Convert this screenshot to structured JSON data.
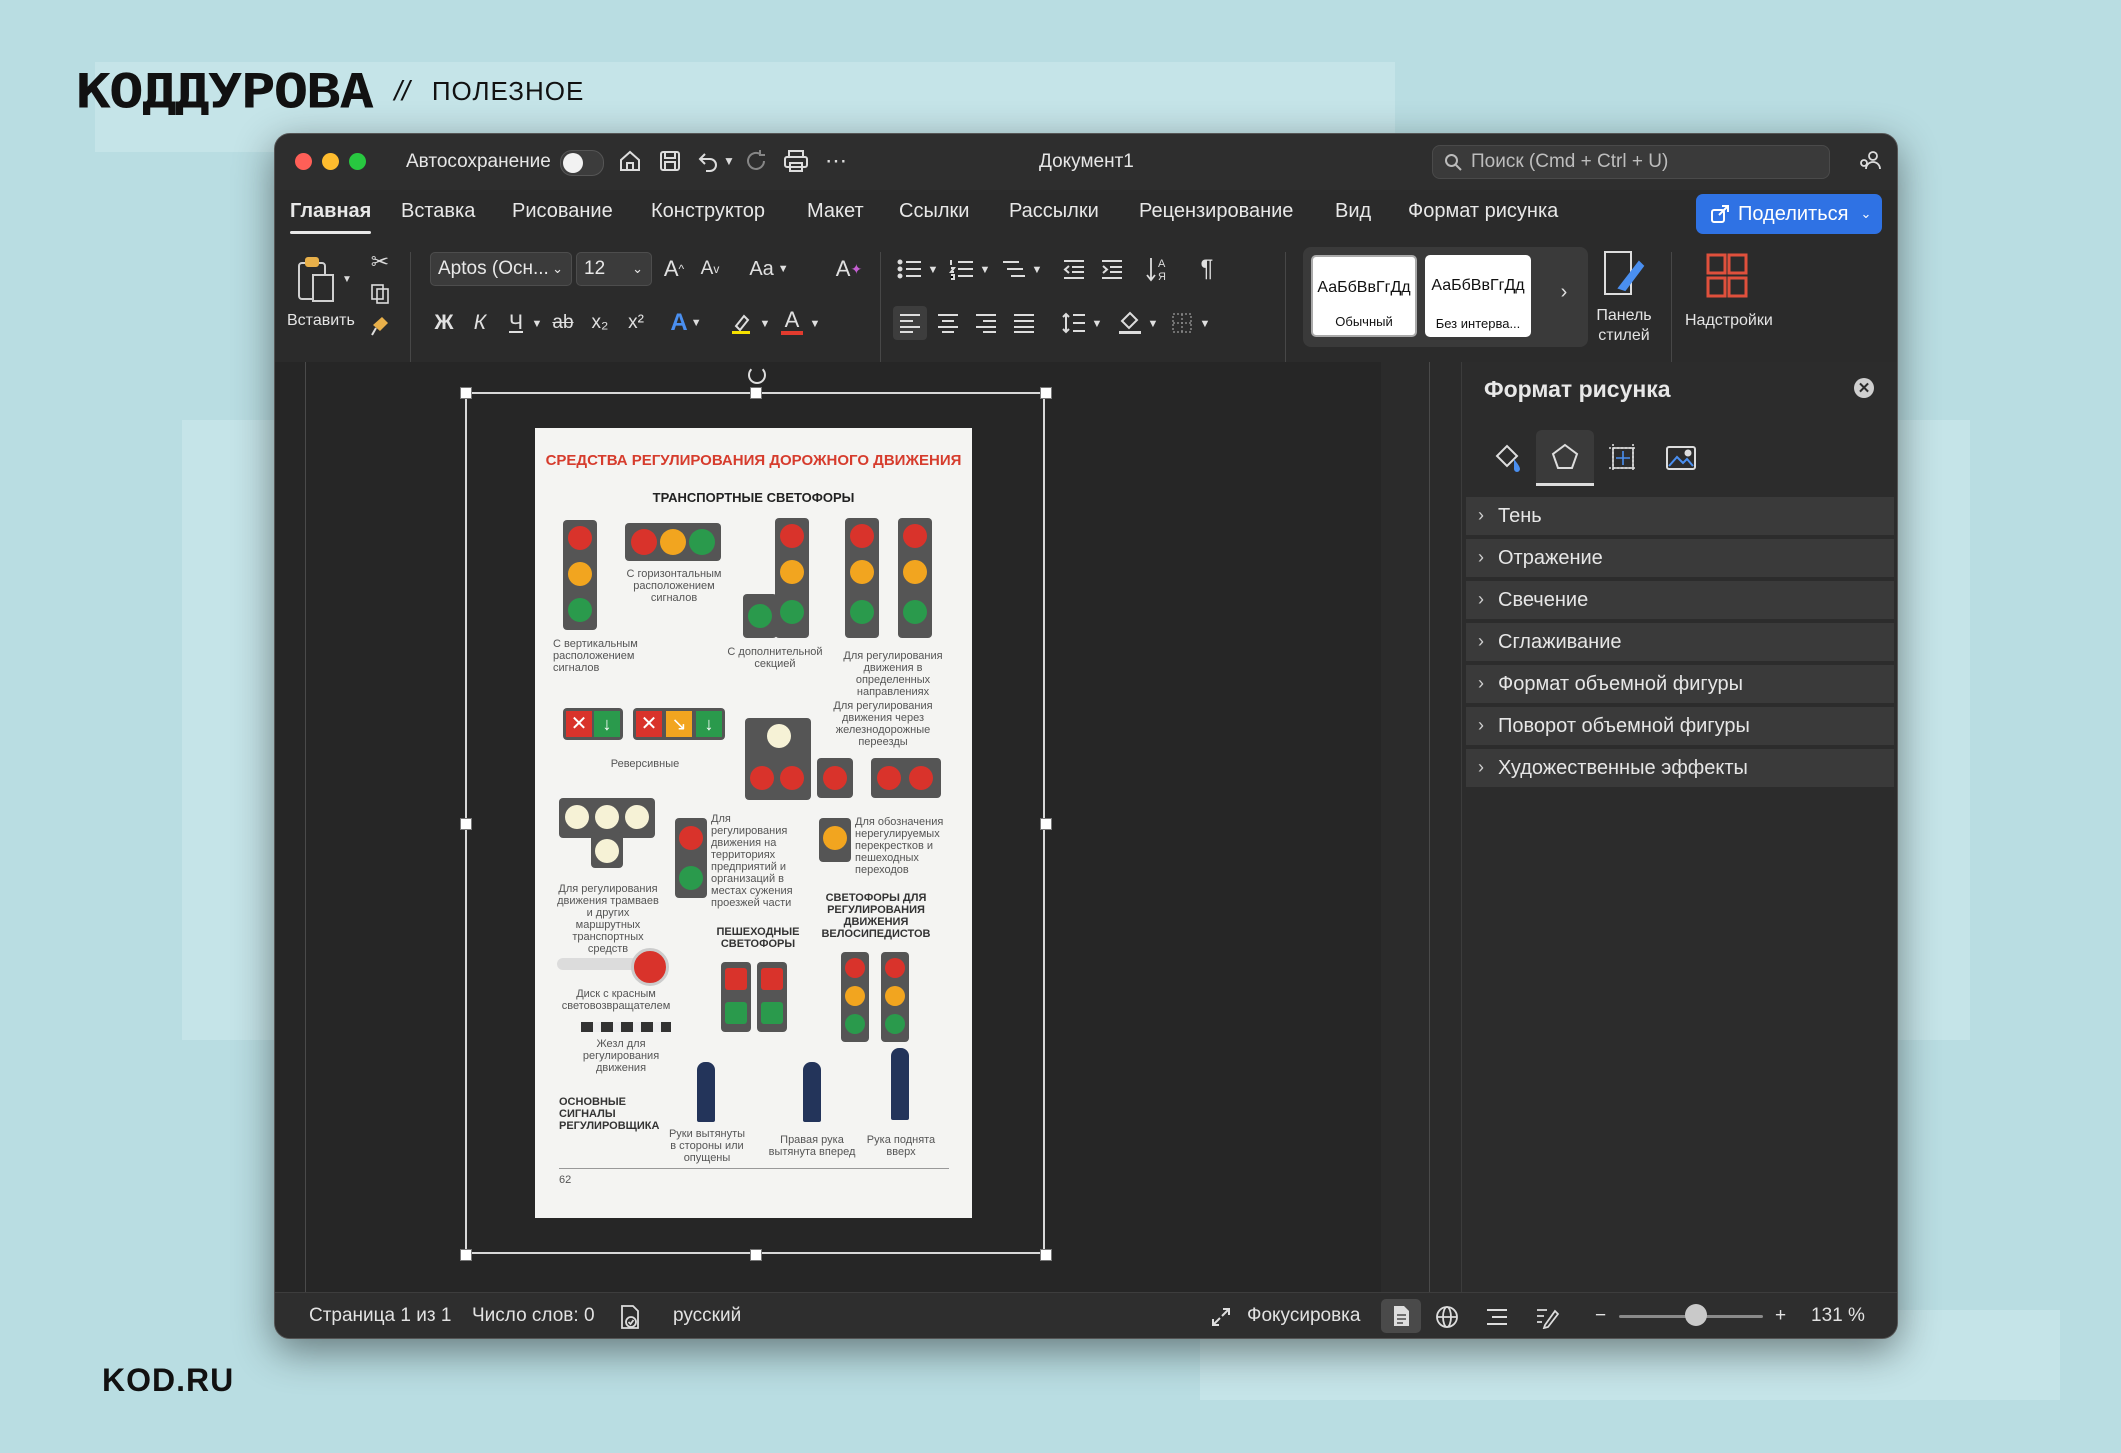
{
  "brand": {
    "logo": "КОДДУРОВА",
    "divider": "//",
    "section": "ПОЛЕЗНОЕ",
    "site": "KOD.RU"
  },
  "window": {
    "autosave_label": "Автосохранение",
    "document_title": "Документ1",
    "search_placeholder": "Поиск (Cmd + Ctrl + U)",
    "colors": {
      "close": "#ff5f57",
      "minimize": "#febc2e",
      "maximize": "#28c840",
      "accent": "#2f72e4"
    }
  },
  "tabs": [
    "Главная",
    "Вставка",
    "Рисование",
    "Конструктор",
    "Макет",
    "Ссылки",
    "Рассылки",
    "Рецензирование",
    "Вид",
    "Формат рисунка"
  ],
  "share_label": "Поделиться",
  "ribbon": {
    "paste_label": "Вставить",
    "font_name": "Aptos (Осн...",
    "font_size": "12",
    "bold": "Ж",
    "italic": "К",
    "underline": "Ч",
    "strike": "ab",
    "subscript": "x₂",
    "superscript": "x²",
    "case_label": "Aa",
    "styles": [
      {
        "sample": "АаБбВвГгДд",
        "name": "Обычный"
      },
      {
        "sample": "АаБбВвГгДд",
        "name": "Без интерва..."
      }
    ],
    "styles_pane_label": "Панель стилей",
    "addins_label": "Надстройки"
  },
  "poster": {
    "title": "СРЕДСТВА РЕГУЛИРОВАНИЯ ДОРОЖНОГО ДВИЖЕНИЯ",
    "subtitle": "ТРАНСПОРТНЫЕ СВЕТОФОРЫ",
    "captions": {
      "vertical": "С вертикальным расположением сигналов",
      "horizontal": "С горизонтальным расположением сигналов",
      "extra": "С дополнительной секцией",
      "directions": "Для регулирования движения в определенных направлениях",
      "reversible": "Реверсивные",
      "railway": "Для регулирования движения через железнодорожные переезды",
      "tram": "Для регулирования движения трамваев и других маршрутных транспортных средств",
      "territories": "Для регулирования движения на территориях предприятий и организаций в местах сужения проезжей части",
      "unregulated": "Для обозначения нерегулируемых перекрестков и пешеходных переходов",
      "pedestrian": "ПЕШЕХОДНЫЕ СВЕТОФОРЫ",
      "cyclists": "СВЕТОФОРЫ ДЛЯ РЕГУЛИРОВАНИЯ ДВИЖЕНИЯ ВЕЛОСИПЕДИСТОВ",
      "disk": "Диск с красным световозвращателем",
      "baton": "Жезл для регулирования движения",
      "signals": "ОСНОВНЫЕ СИГНАЛЫ РЕГУЛИРОВЩИКА",
      "arms_side": "Руки вытянуты в стороны или опущены",
      "arm_forward": "Правая рука вытянута вперед",
      "arm_up": "Рука поднята вверх",
      "page_no": "62"
    }
  },
  "format_panel": {
    "title": "Формат рисунка",
    "sections": [
      "Тень",
      "Отражение",
      "Свечение",
      "Сглаживание",
      "Формат объемной фигуры",
      "Поворот объемной фигуры",
      "Художественные эффекты"
    ]
  },
  "status": {
    "page": "Страница 1 из 1",
    "words": "Число слов: 0",
    "language": "русский",
    "focus": "Фокусировка",
    "zoom": "131 %",
    "zoom_level_percent": 131
  }
}
